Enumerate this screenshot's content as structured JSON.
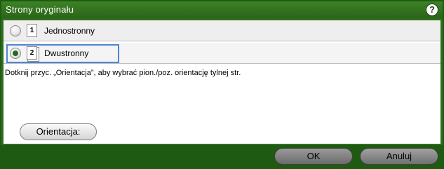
{
  "window": {
    "title": "Strony oryginału",
    "help_glyph": "?"
  },
  "options": [
    {
      "page_number": "1",
      "label": "Jednostronny",
      "selected": false
    },
    {
      "page_number": "2",
      "label": "Dwustronny",
      "selected": true
    }
  ],
  "info_text": "Dotknij przyc. „Orientacja”, aby wybrać pion./poz. orientację tylnej str.",
  "buttons": {
    "orientation": "Orientacja:",
    "ok": "OK",
    "cancel": "Anuluj"
  },
  "colors": {
    "title_bar": "#2f6e1e",
    "selection_outline": "#4d86d6",
    "radio_dot": "#1f6f1a"
  },
  "icons": {
    "help": "help-circle-icon",
    "page": "page-icon"
  }
}
